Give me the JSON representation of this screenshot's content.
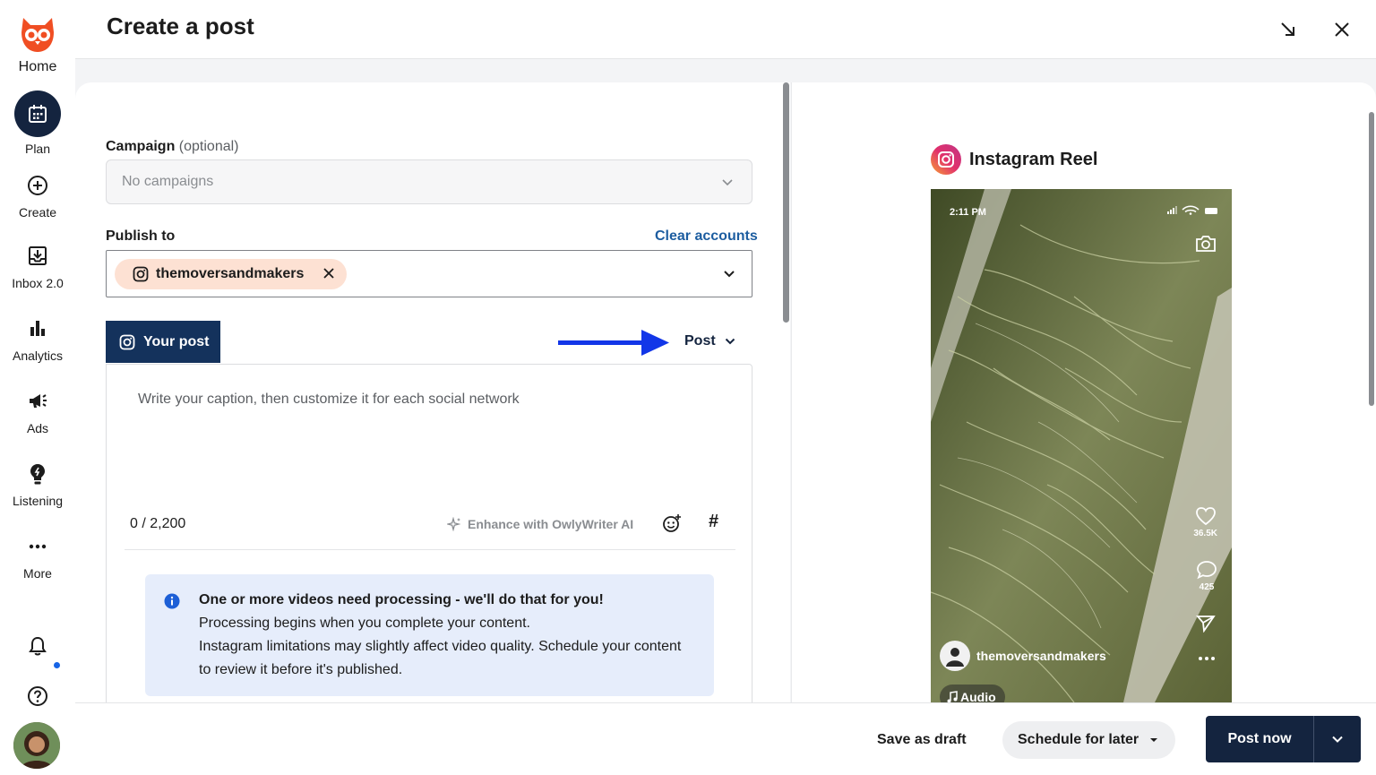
{
  "sidebar": {
    "items": [
      {
        "label": "Home",
        "icon": "owl-logo-icon"
      },
      {
        "label": "Plan",
        "icon": "calendar-icon"
      },
      {
        "label": "Create",
        "icon": "plus-circle-icon"
      },
      {
        "label": "Inbox 2.0",
        "icon": "inbox-icon"
      },
      {
        "label": "Analytics",
        "icon": "bar-chart-icon"
      },
      {
        "label": "Ads",
        "icon": "megaphone-icon"
      },
      {
        "label": "Listening",
        "icon": "lightbulb-icon"
      },
      {
        "label": "More",
        "icon": "more-dots-icon"
      }
    ],
    "notifications_icon": "bell-icon",
    "help_icon": "help-icon",
    "accent": "#f04e23",
    "active_bg": "#14243f"
  },
  "header": {
    "title": "Create a post",
    "minimize_icon": "minimize-arrow-icon",
    "close_icon": "close-icon"
  },
  "composer": {
    "campaign": {
      "label": "Campaign",
      "optional": "(optional)",
      "placeholder": "No campaigns"
    },
    "publish_to": {
      "label": "Publish to",
      "clear_label": "Clear accounts",
      "account": "themoversandmakers"
    },
    "tab_label": "Your post",
    "post_type": "Post",
    "caption_placeholder": "Write your caption, then customize it for each social network",
    "char_count": "0 / 2,200",
    "enhance_label": "Enhance with OwlyWriter AI",
    "hashtag_label": "#",
    "info": {
      "title": "One or more videos need processing - we'll do that for you!",
      "line1": "Processing begins when you complete your content.",
      "line2": "Instagram limitations may slightly affect video quality. Schedule your content",
      "line3": "to review it before it's published."
    }
  },
  "preview": {
    "title": "Instagram Reel",
    "time": "2:11 PM",
    "likes": "36.5K",
    "comments": "425",
    "username": "themoversandmakers",
    "audio": "Audio"
  },
  "footer": {
    "save_draft": "Save as draft",
    "schedule": "Schedule for later",
    "post_now": "Post now"
  }
}
